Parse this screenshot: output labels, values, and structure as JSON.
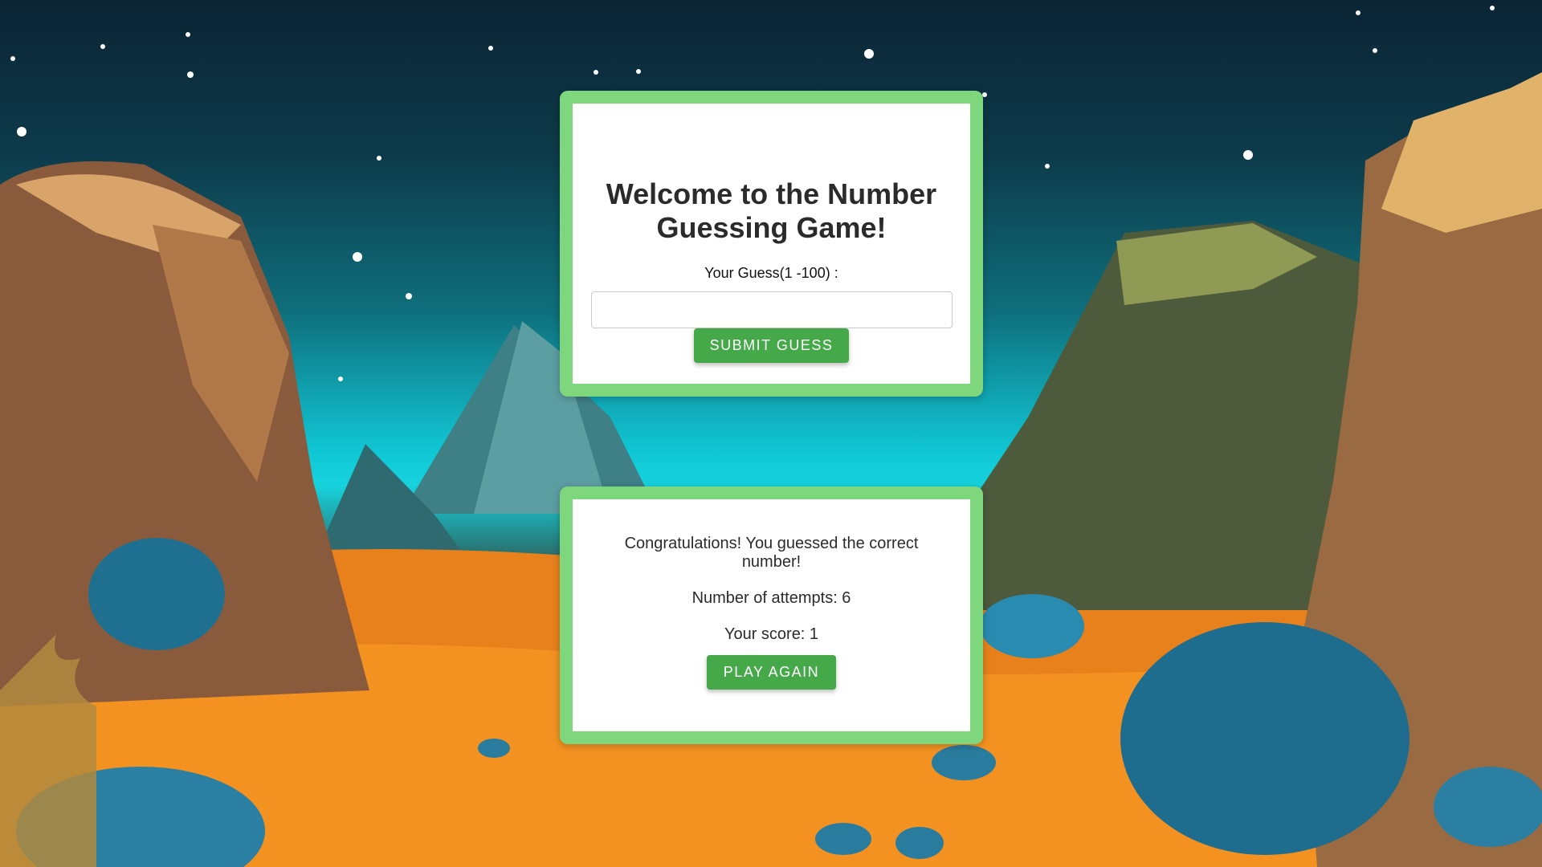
{
  "game": {
    "title": "Welcome to the Number Guessing Game!",
    "guess_label": "Your Guess(1 -100) :",
    "guess_value": "",
    "submit_label": "SUBMIT GUESS"
  },
  "result": {
    "message": "Congratulations! You guessed the correct number!",
    "attempts_text": "Number of attempts: 6",
    "score_text": "Your score: 1",
    "play_again_label": "PLAY AGAIN"
  },
  "colors": {
    "card_border": "#7ed77d",
    "button": "#45a94a"
  }
}
